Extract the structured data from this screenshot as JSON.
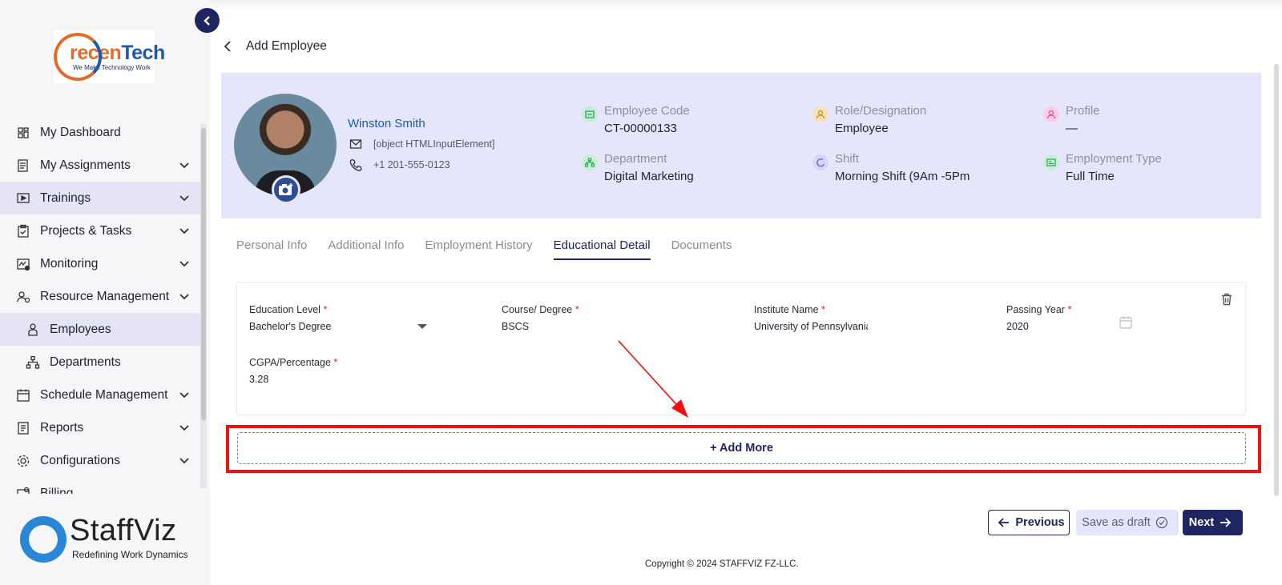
{
  "sidebar": {
    "company_logo": {
      "part1": "recen",
      "part2": "Tech",
      "tagline": "We Make Technology Work"
    },
    "items": [
      {
        "label": "My Dashboard",
        "icon": "dashboard-icon"
      },
      {
        "label": "My Assignments",
        "icon": "assignments-icon"
      },
      {
        "label": "Trainings",
        "icon": "trainings-icon"
      },
      {
        "label": "Projects & Tasks",
        "icon": "projects-icon"
      },
      {
        "label": "Monitoring",
        "icon": "monitoring-icon"
      },
      {
        "label": "Resource Management",
        "icon": "resource-icon"
      },
      {
        "label": "Employees",
        "icon": "employees-icon"
      },
      {
        "label": "Departments",
        "icon": "departments-icon"
      },
      {
        "label": "Schedule Management",
        "icon": "schedule-icon"
      },
      {
        "label": "Reports",
        "icon": "reports-icon"
      },
      {
        "label": "Configurations",
        "icon": "configurations-icon"
      },
      {
        "label": "Billing",
        "icon": "billing-icon"
      }
    ],
    "product_logo": {
      "name": "StaffViz",
      "tagline": "Redefining Work Dynamics"
    }
  },
  "header": {
    "title": "Add Employee"
  },
  "profile": {
    "name": "Winston Smith",
    "email": "[object HTMLInputElement]",
    "phone": "+1 201-555-0123",
    "employee_code_label": "Employee Code",
    "employee_code": "CT-00000133",
    "department_label": "Department",
    "department": "Digital Marketing",
    "role_label": "Role/Designation",
    "role": "Employee",
    "shift_label": "Shift",
    "shift": "Morning Shift (9Am -5Pm",
    "profile_label": "Profile",
    "profile_value": "—",
    "employment_type_label": "Employment Type",
    "employment_type": "Full Time"
  },
  "tabs": [
    {
      "label": "Personal Info"
    },
    {
      "label": "Additional Info"
    },
    {
      "label": "Employment History"
    },
    {
      "label": "Educational Detail"
    },
    {
      "label": "Documents"
    }
  ],
  "education": {
    "level_label": "Education Level",
    "level_value": "Bachelor's Degree",
    "course_label": "Course/ Degree",
    "course_value": "BSCS",
    "institute_label": "Institute Name",
    "institute_value": "University of Pennsylvania",
    "year_label": "Passing Year",
    "year_value": "2020",
    "cgpa_label": "CGPA/Percentage",
    "cgpa_value": "3.28",
    "required_mark": "*"
  },
  "actions": {
    "add_more": "+ Add More",
    "previous": "Previous",
    "save_draft": "Save as draft",
    "next": "Next"
  },
  "footer": {
    "copyright": "Copyright © 2024 STAFFVIZ FZ-LLC."
  },
  "colors": {
    "primary": "#1f2561",
    "highlight": "#ee1111",
    "profile_bg": "#e5e6fb",
    "sidebar_active": "#e4e4f5"
  }
}
